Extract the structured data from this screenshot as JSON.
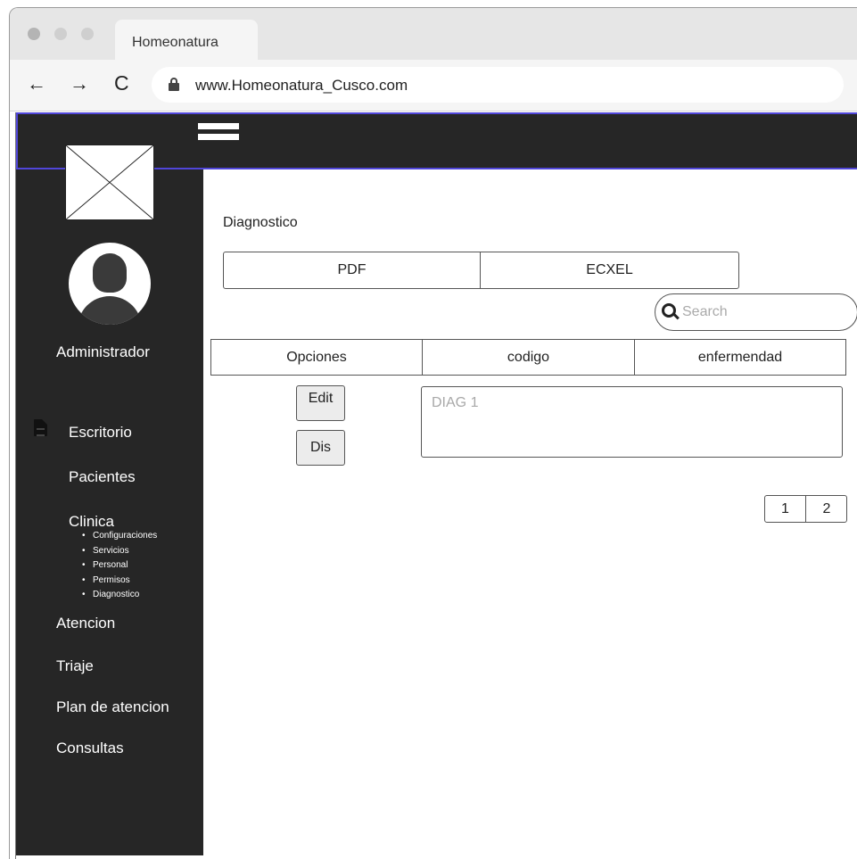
{
  "browser": {
    "tab_title": "Homeonatura",
    "url": "www.Homeonatura_Cusco.com",
    "traffic_light_colors": [
      "#b4b4b4",
      "#cfcfcf",
      "#cfcfcf"
    ]
  },
  "sidebar": {
    "user_name": "Administrador",
    "items": [
      {
        "label": "Escritorio"
      },
      {
        "label": "Pacientes"
      },
      {
        "label": "Clinica"
      },
      {
        "label": "Atencion"
      },
      {
        "label": "Triaje"
      },
      {
        "label": "Plan de atencion"
      },
      {
        "label": "Consultas"
      }
    ],
    "clinica_subitems": [
      "Configuraciones",
      "Servicios",
      "Personal",
      "Permisos",
      "Diagnostico"
    ]
  },
  "main": {
    "title": "Diagnostico",
    "export_buttons": {
      "pdf": "PDF",
      "excel": "ECXEL"
    },
    "search": {
      "placeholder": "Search"
    },
    "table": {
      "headers": [
        "Opciones",
        "codigo",
        "enfermendad"
      ],
      "row": {
        "edit_label": "Edit",
        "dis_label": "Dis",
        "field_placeholder": "DIAG 1"
      }
    },
    "pagination": [
      "1",
      "2"
    ]
  },
  "colors": {
    "dark": "#262626",
    "topbar_border": "#5046d9"
  }
}
